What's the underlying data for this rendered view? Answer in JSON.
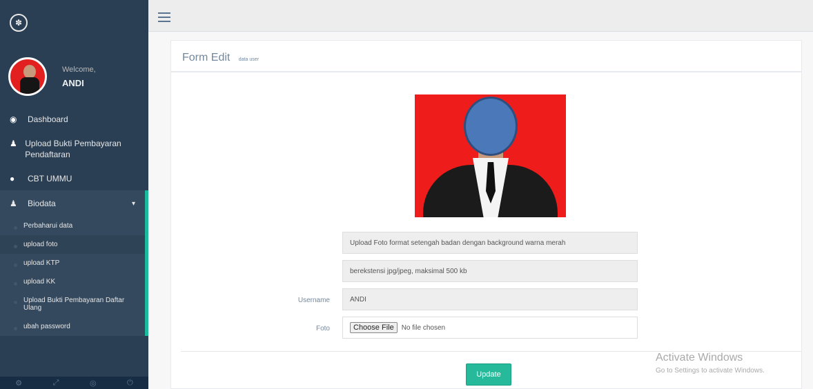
{
  "sidebar": {
    "profile": {
      "welcome": "Welcome,",
      "name": "ANDI"
    },
    "menu": {
      "dashboard": "Dashboard",
      "upload_pendaftaran": "Upload Bukti Pembayaran Pendaftaran",
      "cbt": "CBT UMMU",
      "biodata": "Biodata"
    },
    "submenu": [
      "Perbaharui data",
      "upload foto",
      "upload KTP",
      "upload KK",
      "Upload Bukti Pembayaran Daftar Ulang",
      "ubah password"
    ]
  },
  "panel": {
    "title": "Form Edit",
    "subtitle": "data user",
    "info_line_1": "Upload Foto format setengah badan dengan background warna merah",
    "info_line_2": "berekstensi jpg/jpeg, maksimal 500 kb",
    "username_label": "Username",
    "username_value": "ANDI",
    "foto_label": "Foto",
    "choose_file": "Choose File",
    "no_file": "No file chosen",
    "update_label": "Update"
  },
  "watermark": {
    "line1": "Activate Windows",
    "line2": "Go to Settings to activate Windows."
  },
  "colors": {
    "sidebar": "#2a3f54",
    "accent": "#1abb9c",
    "button": "#26b99a",
    "photo_bg": "#ef1c1c"
  }
}
